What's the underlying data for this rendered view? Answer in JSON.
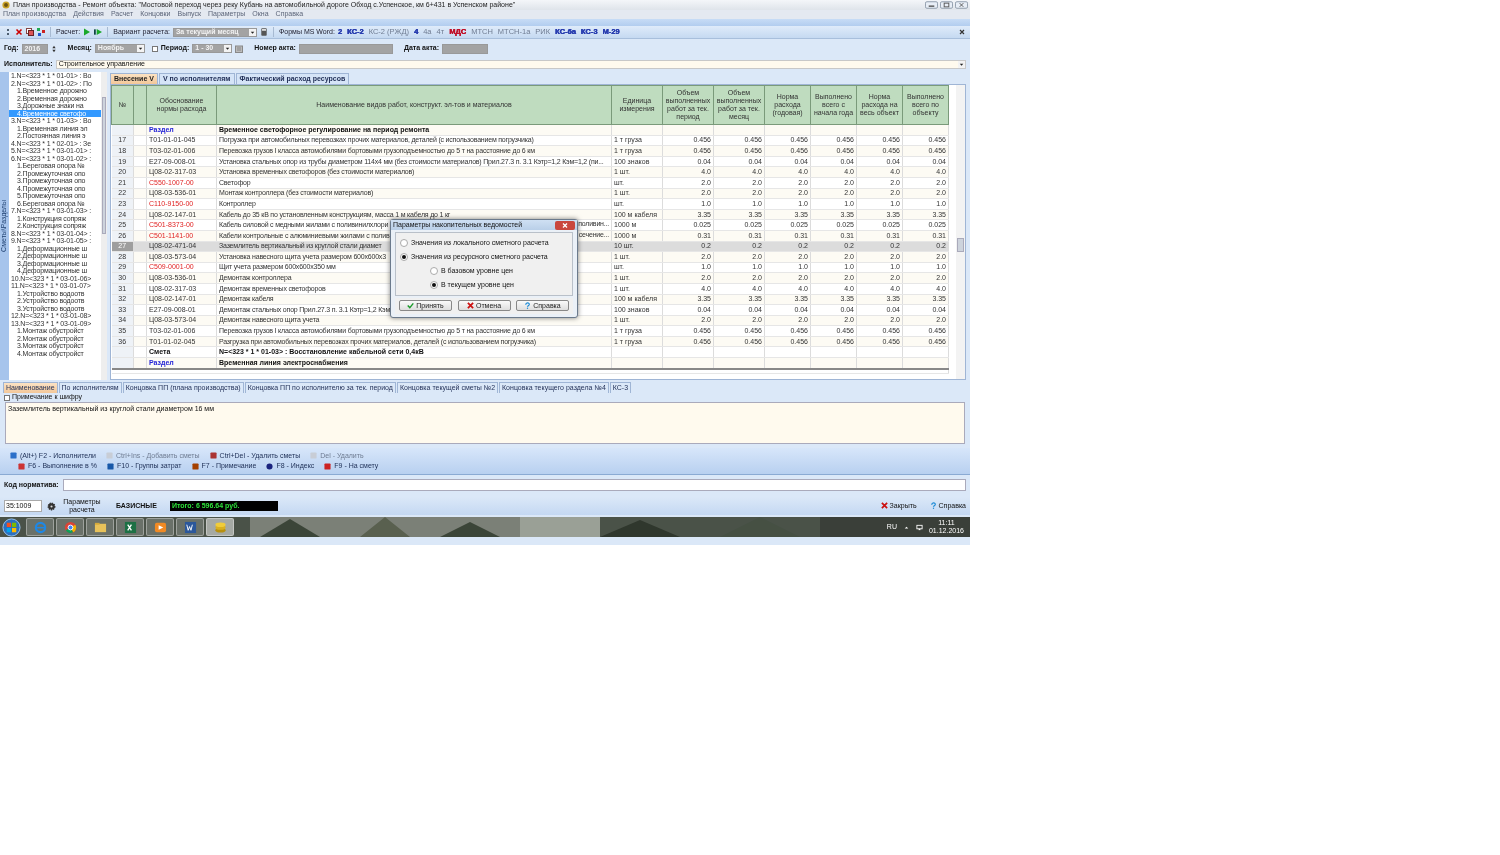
{
  "window": {
    "title": "План производства - Ремонт объекта: \"Мостовой переход через реку Кубань на автомобильной дороге Обход с.Успенское, км 6+431 в Успенском районе\""
  },
  "menu": [
    "План производства",
    "Действия",
    "Расчет",
    "Концовки",
    "Выпуск",
    "Параметры",
    "Окна",
    "Справка"
  ],
  "toolbar": {
    "calc_label": "Расчет:",
    "variant_label": "Вариант расчета:",
    "variant": {
      "value": "За текущий месяц",
      "disabled": true
    },
    "word_label": "Формы MS Word:",
    "word_links": [
      {
        "label": "2",
        "disabled": false,
        "color": "#2a3fb0"
      },
      {
        "label": "КС-2",
        "disabled": false,
        "color": "#2a3fb0"
      },
      {
        "label": "КС-2 (РЖД)",
        "disabled": true
      },
      {
        "label": "4",
        "disabled": false,
        "color": "#2a3fb0"
      },
      {
        "label": "4а",
        "disabled": true
      },
      {
        "label": "4т",
        "disabled": true
      },
      {
        "label": "МДС",
        "disabled": false,
        "color": "#c0102a"
      },
      {
        "label": "МТСН",
        "disabled": true
      },
      {
        "label": "МТСН-1а",
        "disabled": true
      },
      {
        "label": "РИК",
        "disabled": true
      },
      {
        "label": "КС-6а",
        "disabled": false,
        "color": "#2a3fb0"
      },
      {
        "label": "КС-3",
        "disabled": false,
        "color": "#2a3fb0"
      },
      {
        "label": "М-29",
        "disabled": false,
        "color": "#2a3fb0"
      }
    ]
  },
  "params": {
    "year": {
      "label": "Год:",
      "value": "2016",
      "disabled": true
    },
    "month": {
      "label": "Месяц:",
      "value": "Ноябрь",
      "disabled": true
    },
    "period": {
      "label": "Период:",
      "checked": false,
      "value": "1 - 30",
      "disabled": true
    },
    "act_number": {
      "label": "Номер акта:",
      "disabled": true
    },
    "act_date": {
      "label": "Дата акта:",
      "disabled": true
    }
  },
  "executor": {
    "label": "Исполнитель:",
    "value": "Строительное управление"
  },
  "sidebar": {
    "title": "Сметы\\Разделы",
    "items": [
      {
        "label": "1.N=<323 * 1 * 01-01> : Во",
        "selected": false
      },
      {
        "label": "2.N=<323 * 1 * 01-02> : По",
        "selected": false,
        "children": [
          {
            "label": "1.Временное дорожно",
            "selected": false
          },
          {
            "label": "2.Временная дорожно",
            "selected": false
          },
          {
            "label": "3.Дорожные знаки на",
            "selected": false
          },
          {
            "label": "4.Временное светофо",
            "selected": true
          }
        ]
      },
      {
        "label": "3.N=<323 * 1 * 01-03> : Во",
        "selected": false,
        "children": [
          {
            "label": "1.Временная линия эл",
            "selected": false
          },
          {
            "label": "2.Постоянная линия э",
            "selected": false
          }
        ]
      },
      {
        "label": "4.N=<323 * 1 * 02-01> : Зе",
        "selected": false
      },
      {
        "label": "5.N=<323 * 1 * 03-01-01> :",
        "selected": false
      },
      {
        "label": "6.N=<323 * 1 * 03-01-02> :",
        "selected": false,
        "children": [
          {
            "label": "1.Береговая опора №",
            "selected": false
          },
          {
            "label": "2.Промежуточная опо",
            "selected": false
          },
          {
            "label": "3.Промежуточная опо",
            "selected": false
          },
          {
            "label": "4.Промежуточная опо",
            "selected": false
          },
          {
            "label": "5.Промежуточная опо",
            "selected": false
          },
          {
            "label": "6.Береговая опора №",
            "selected": false
          }
        ]
      },
      {
        "label": "7.N=<323 * 1 * 03-01-03> :",
        "selected": false,
        "children": [
          {
            "label": "1.Конструкция сопряж",
            "selected": false
          },
          {
            "label": "2.Конструкция сопряж",
            "selected": false
          }
        ]
      },
      {
        "label": "8.N=<323 * 1 * 03-01-04> :",
        "selected": false
      },
      {
        "label": "9.N=<323 * 1 * 03-01-05> :",
        "selected": false,
        "children": [
          {
            "label": "1.Деформационные ш",
            "selected": false
          },
          {
            "label": "2.Деформационные ш",
            "selected": false
          },
          {
            "label": "3.Деформационные ш",
            "selected": false
          },
          {
            "label": "4.Деформационные ш",
            "selected": false
          }
        ]
      },
      {
        "label": "10.N=<323 * 1 * 03-01-06>",
        "selected": false
      },
      {
        "label": "11.N=<323 * 1 * 03-01-07>",
        "selected": false,
        "children": [
          {
            "label": "1.Устройство водоотв",
            "selected": false
          },
          {
            "label": "2.Устройство водоотв",
            "selected": false
          },
          {
            "label": "3.Устройство водоотв",
            "selected": false
          }
        ]
      },
      {
        "label": "12.N=<323 * 1 * 03-01-08>",
        "selected": false
      },
      {
        "label": "13.N=<323 * 1 * 03-01-09>",
        "selected": false,
        "children": [
          {
            "label": "1.Монтаж обустройст",
            "selected": false
          },
          {
            "label": "2.Монтаж обустройст",
            "selected": false
          },
          {
            "label": "3.Монтаж обустройст",
            "selected": false
          },
          {
            "label": "4.Монтаж обустройст",
            "selected": false
          }
        ]
      }
    ]
  },
  "tabs": [
    {
      "label": "Внесение V",
      "selected": true
    },
    {
      "label": "V по исполнителям",
      "selected": false
    },
    {
      "label": "Фактический расход ресурсов",
      "selected": false
    }
  ],
  "table": {
    "columns": [
      "№",
      "Обоснование нормы расхода",
      "Наименование видов работ, конструкт. эл-тов и материалов",
      "Единица измерения",
      "Объем выполненных работ за тек. период",
      "Объем выполненных работ за тек. месяц",
      "Норма расхода (годовая)",
      "Выполнено всего с начала года",
      "Норма расхода на весь объект",
      "Выполнено всего по объекту"
    ],
    "rows": [
      {
        "kind": "section",
        "label": "Раздел",
        "title": "Временное светофорное регулирование на период ремонта",
        "selected": false
      },
      {
        "kind": "work",
        "num": "17",
        "code": "Т01-01-01-045",
        "name": "Погрузка при автомобильных перевозках прочих материалов, деталей (с использованием погрузчика)",
        "unit": "1 т груза",
        "values": [
          "0.456",
          "0.456",
          "0.456",
          "0.456",
          "0.456",
          "0.456"
        ],
        "selected": false
      },
      {
        "kind": "work",
        "num": "18",
        "code": "Т03-02-01-006",
        "name": "Перевозка грузов I класса автомобилями бортовыми грузоподъемностью до 5 т на расстояние до 6 км",
        "unit": "1 т груза",
        "values": [
          "0.456",
          "0.456",
          "0.456",
          "0.456",
          "0.456",
          "0.456"
        ],
        "selected": false
      },
      {
        "kind": "work",
        "num": "19",
        "code": "Е27-09-008-01",
        "name": "Установка стальных опор из трубы диаметром 114х4 мм (без стоимости материалов) Прил.27.3 п. 3.1 Кэтр=1,2 Кэм=1,2 (пи...",
        "unit": "100 знаков",
        "values": [
          "0.04",
          "0.04",
          "0.04",
          "0.04",
          "0.04",
          "0.04"
        ],
        "selected": false
      },
      {
        "kind": "work",
        "num": "20",
        "code": "Ц08-02-317-03",
        "name": "Установка временных светофоров (без стоимости материалов)",
        "unit": "1 шт.",
        "values": [
          "4.0",
          "4.0",
          "4.0",
          "4.0",
          "4.0",
          "4.0"
        ],
        "selected": false
      },
      {
        "kind": "material",
        "num": "21",
        "code": "С550-1007-00",
        "name": "Светофор",
        "unit": "шт.",
        "values": [
          "2.0",
          "2.0",
          "2.0",
          "2.0",
          "2.0",
          "2.0"
        ],
        "selected": false
      },
      {
        "kind": "work",
        "num": "22",
        "code": "Ц08-03-536-01",
        "name": "Монтаж контроллера (без стоимости материалов)",
        "unit": "1 шт.",
        "values": [
          "2.0",
          "2.0",
          "2.0",
          "2.0",
          "2.0",
          "2.0"
        ],
        "selected": false
      },
      {
        "kind": "material",
        "num": "23",
        "code": "С110-9150-00",
        "name": "Контроллер",
        "unit": "шт.",
        "values": [
          "1.0",
          "1.0",
          "1.0",
          "1.0",
          "1.0",
          "1.0"
        ],
        "selected": false
      },
      {
        "kind": "work",
        "num": "24",
        "code": "Ц08-02-147-01",
        "name": "Кабель до 35 кВ по установленным конструкциям, масса 1 м кабеля до 1 кг",
        "unit": "100 м кабеля",
        "values": [
          "3.35",
          "3.35",
          "3.35",
          "3.35",
          "3.35",
          "3.35"
        ],
        "selected": false
      },
      {
        "kind": "material",
        "num": "25",
        "code": "С501-8373-00",
        "name": "Кабель силовой с медными жилами с поливинилхлори",
        "tail": "поливин...",
        "unit": "1000 м",
        "values": [
          "0.025",
          "0.025",
          "0.025",
          "0.025",
          "0.025",
          "0.025"
        ],
        "selected": false
      },
      {
        "kind": "material",
        "num": "26",
        "code": "С501-1141-00",
        "name": "Кабели контрольные с алюминиевыми жилами с полив",
        "tail": "сечение...",
        "unit": "1000 м",
        "values": [
          "0.31",
          "0.31",
          "0.31",
          "0.31",
          "0.31",
          "0.31"
        ],
        "selected": false
      },
      {
        "kind": "work",
        "num": "27",
        "code": "Ц08-02-471-04",
        "name": "Заземлитель вертикальный из круглой стали диамет",
        "unit": "10 шт.",
        "values": [
          "0.2",
          "0.2",
          "0.2",
          "0.2",
          "0.2",
          "0.2"
        ],
        "selected": true
      },
      {
        "kind": "work",
        "num": "28",
        "code": "Ц08-03-573-04",
        "name": "Установка навесного щита учета размером 600х600х3",
        "unit": "1 шт.",
        "values": [
          "2.0",
          "2.0",
          "2.0",
          "2.0",
          "2.0",
          "2.0"
        ],
        "selected": false
      },
      {
        "kind": "material",
        "num": "29",
        "code": "С509-0001-00",
        "name": "Щит учета размером 600х600х350 мм",
        "unit": "шт.",
        "values": [
          "1.0",
          "1.0",
          "1.0",
          "1.0",
          "1.0",
          "1.0"
        ],
        "selected": false
      },
      {
        "kind": "work",
        "num": "30",
        "code": "Ц08-03-536-01",
        "name": "Демонтаж контроллера",
        "unit": "1 шт.",
        "values": [
          "2.0",
          "2.0",
          "2.0",
          "2.0",
          "2.0",
          "2.0"
        ],
        "selected": false
      },
      {
        "kind": "work",
        "num": "31",
        "code": "Ц08-02-317-03",
        "name": "Демонтаж временных светофоров",
        "unit": "1 шт.",
        "values": [
          "4.0",
          "4.0",
          "4.0",
          "4.0",
          "4.0",
          "4.0"
        ],
        "selected": false
      },
      {
        "kind": "work",
        "num": "32",
        "code": "Ц08-02-147-01",
        "name": "Демонтаж кабеля",
        "unit": "100 м кабеля",
        "values": [
          "3.35",
          "3.35",
          "3.35",
          "3.35",
          "3.35",
          "3.35"
        ],
        "selected": false
      },
      {
        "kind": "work",
        "num": "33",
        "code": "Е27-09-008-01",
        "name": "Демонтаж стальных опор Прил.27.3 п. 3.1 Кэтр=1,2 Кэм",
        "unit": "100 знаков",
        "values": [
          "0.04",
          "0.04",
          "0.04",
          "0.04",
          "0.04",
          "0.04"
        ],
        "selected": false
      },
      {
        "kind": "work",
        "num": "34",
        "code": "Ц08-03-573-04",
        "name": "Демонтаж навесного щита учета",
        "unit": "1 шт.",
        "values": [
          "2.0",
          "2.0",
          "2.0",
          "2.0",
          "2.0",
          "2.0"
        ],
        "selected": false
      },
      {
        "kind": "work",
        "num": "35",
        "code": "Т03-02-01-006",
        "name": "Перевозка грузов I класса автомобилями бортовыми грузоподъемностью до 5 т на расстояние до 6 км",
        "unit": "1 т груза",
        "values": [
          "0.456",
          "0.456",
          "0.456",
          "0.456",
          "0.456",
          "0.456"
        ],
        "selected": false
      },
      {
        "kind": "work",
        "num": "36",
        "code": "Т01-01-02-045",
        "name": "Разгрузка при автомобильных перевозках прочих материалов, деталей (с использованием погрузчика)",
        "unit": "1 т груза",
        "values": [
          "0.456",
          "0.456",
          "0.456",
          "0.456",
          "0.456",
          "0.456"
        ],
        "selected": false
      },
      {
        "kind": "estimate",
        "label": "Смета",
        "title": "N=<323 * 1 * 01-03> : Восстановление кабельной сети 0,4кВ",
        "selected": false
      },
      {
        "kind": "section",
        "label": "Раздел",
        "title": "Временная линия электроснабжения",
        "selected": false
      }
    ]
  },
  "dialog": {
    "title": "Параметры накопительных ведомостей",
    "sources": [
      {
        "label": "Значения из локального сметного расчета",
        "selected": false
      },
      {
        "label": "Значения из ресурсного сметного расчета",
        "selected": true
      }
    ],
    "price_levels": [
      {
        "label": "В базовом уровне цен",
        "selected": false
      },
      {
        "label": "В текущем уровне цен",
        "selected": true
      }
    ],
    "buttons": [
      {
        "label": "Принять",
        "kind": "ok"
      },
      {
        "label": "Отмена",
        "kind": "cancel"
      },
      {
        "label": "Справка",
        "kind": "help"
      }
    ]
  },
  "bottom_tabs": [
    {
      "label": "Наименование",
      "selected": true
    },
    {
      "label": "По исполнителям",
      "selected": false
    },
    {
      "label": "Концовка ПП (плана производства)",
      "selected": false
    },
    {
      "label": "Концовка ПП по исполнителю за тек. период",
      "selected": false
    },
    {
      "label": "Концовка текущей сметы №2",
      "selected": false
    },
    {
      "label": "Концовка текущего раздела №4",
      "selected": false
    },
    {
      "label": "КС-3",
      "selected": false
    }
  ],
  "note": {
    "label": "Примечание к шифру",
    "checked": false,
    "text": "Заземлитель вертикальный из круглой стали диаметром 16 мм"
  },
  "actions": [
    [
      {
        "label": "(Alt+) F2 - Исполнители",
        "disabled": false
      },
      {
        "label": "Ctrl+Ins - Добавить сметы",
        "disabled": true
      },
      {
        "label": "Ctrl+Del - Удалить сметы",
        "disabled": false
      },
      {
        "label": "Del - Удалить",
        "disabled": true
      }
    ],
    [
      {
        "label": "F6 - Выполнение в %",
        "disabled": false
      },
      {
        "label": "F10 - Группы затрат",
        "disabled": false
      },
      {
        "label": "F7 - Примечание",
        "disabled": false
      },
      {
        "label": "F8 - Индекс",
        "disabled": false
      },
      {
        "label": "F9 - На смету",
        "disabled": false
      }
    ]
  ],
  "norm_code": {
    "label": "Код норматива:"
  },
  "status_bar": {
    "position": "35:1009",
    "params_label": "Параметры расчета",
    "mode": "БАЗИСНЫЕ",
    "total": "Итого: 6 596.64 руб.",
    "close": "Закрыть",
    "help": "Справка"
  },
  "taskbar": {
    "apps": [
      {
        "kind": "ie",
        "selected": false
      },
      {
        "kind": "chrome",
        "selected": false
      },
      {
        "kind": "folder",
        "selected": false
      },
      {
        "kind": "excel",
        "selected": false
      },
      {
        "kind": "player",
        "selected": false
      },
      {
        "kind": "word",
        "selected": false
      },
      {
        "kind": "coins",
        "selected": true
      }
    ],
    "language": "RU",
    "time": "11:11",
    "date": "01.12.2016"
  }
}
